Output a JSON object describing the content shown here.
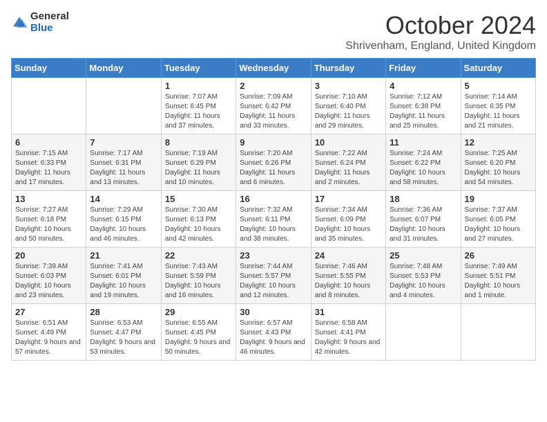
{
  "logo": {
    "general": "General",
    "blue": "Blue"
  },
  "title": "October 2024",
  "subtitle": "Shrivenham, England, United Kingdom",
  "days_of_week": [
    "Sunday",
    "Monday",
    "Tuesday",
    "Wednesday",
    "Thursday",
    "Friday",
    "Saturday"
  ],
  "weeks": [
    [
      {
        "day": "",
        "info": ""
      },
      {
        "day": "",
        "info": ""
      },
      {
        "day": "1",
        "info": "Sunrise: 7:07 AM\nSunset: 6:45 PM\nDaylight: 11 hours and 37 minutes."
      },
      {
        "day": "2",
        "info": "Sunrise: 7:09 AM\nSunset: 6:42 PM\nDaylight: 11 hours and 33 minutes."
      },
      {
        "day": "3",
        "info": "Sunrise: 7:10 AM\nSunset: 6:40 PM\nDaylight: 11 hours and 29 minutes."
      },
      {
        "day": "4",
        "info": "Sunrise: 7:12 AM\nSunset: 6:38 PM\nDaylight: 11 hours and 25 minutes."
      },
      {
        "day": "5",
        "info": "Sunrise: 7:14 AM\nSunset: 6:35 PM\nDaylight: 11 hours and 21 minutes."
      }
    ],
    [
      {
        "day": "6",
        "info": "Sunrise: 7:15 AM\nSunset: 6:33 PM\nDaylight: 11 hours and 17 minutes."
      },
      {
        "day": "7",
        "info": "Sunrise: 7:17 AM\nSunset: 6:31 PM\nDaylight: 11 hours and 13 minutes."
      },
      {
        "day": "8",
        "info": "Sunrise: 7:19 AM\nSunset: 6:29 PM\nDaylight: 11 hours and 10 minutes."
      },
      {
        "day": "9",
        "info": "Sunrise: 7:20 AM\nSunset: 6:26 PM\nDaylight: 11 hours and 6 minutes."
      },
      {
        "day": "10",
        "info": "Sunrise: 7:22 AM\nSunset: 6:24 PM\nDaylight: 11 hours and 2 minutes."
      },
      {
        "day": "11",
        "info": "Sunrise: 7:24 AM\nSunset: 6:22 PM\nDaylight: 10 hours and 58 minutes."
      },
      {
        "day": "12",
        "info": "Sunrise: 7:25 AM\nSunset: 6:20 PM\nDaylight: 10 hours and 54 minutes."
      }
    ],
    [
      {
        "day": "13",
        "info": "Sunrise: 7:27 AM\nSunset: 6:18 PM\nDaylight: 10 hours and 50 minutes."
      },
      {
        "day": "14",
        "info": "Sunrise: 7:29 AM\nSunset: 6:15 PM\nDaylight: 10 hours and 46 minutes."
      },
      {
        "day": "15",
        "info": "Sunrise: 7:30 AM\nSunset: 6:13 PM\nDaylight: 10 hours and 42 minutes."
      },
      {
        "day": "16",
        "info": "Sunrise: 7:32 AM\nSunset: 6:11 PM\nDaylight: 10 hours and 38 minutes."
      },
      {
        "day": "17",
        "info": "Sunrise: 7:34 AM\nSunset: 6:09 PM\nDaylight: 10 hours and 35 minutes."
      },
      {
        "day": "18",
        "info": "Sunrise: 7:36 AM\nSunset: 6:07 PM\nDaylight: 10 hours and 31 minutes."
      },
      {
        "day": "19",
        "info": "Sunrise: 7:37 AM\nSunset: 6:05 PM\nDaylight: 10 hours and 27 minutes."
      }
    ],
    [
      {
        "day": "20",
        "info": "Sunrise: 7:39 AM\nSunset: 6:03 PM\nDaylight: 10 hours and 23 minutes."
      },
      {
        "day": "21",
        "info": "Sunrise: 7:41 AM\nSunset: 6:01 PM\nDaylight: 10 hours and 19 minutes."
      },
      {
        "day": "22",
        "info": "Sunrise: 7:43 AM\nSunset: 5:59 PM\nDaylight: 10 hours and 16 minutes."
      },
      {
        "day": "23",
        "info": "Sunrise: 7:44 AM\nSunset: 5:57 PM\nDaylight: 10 hours and 12 minutes."
      },
      {
        "day": "24",
        "info": "Sunrise: 7:46 AM\nSunset: 5:55 PM\nDaylight: 10 hours and 8 minutes."
      },
      {
        "day": "25",
        "info": "Sunrise: 7:48 AM\nSunset: 5:53 PM\nDaylight: 10 hours and 4 minutes."
      },
      {
        "day": "26",
        "info": "Sunrise: 7:49 AM\nSunset: 5:51 PM\nDaylight: 10 hours and 1 minute."
      }
    ],
    [
      {
        "day": "27",
        "info": "Sunrise: 6:51 AM\nSunset: 4:49 PM\nDaylight: 9 hours and 57 minutes."
      },
      {
        "day": "28",
        "info": "Sunrise: 6:53 AM\nSunset: 4:47 PM\nDaylight: 9 hours and 53 minutes."
      },
      {
        "day": "29",
        "info": "Sunrise: 6:55 AM\nSunset: 4:45 PM\nDaylight: 9 hours and 50 minutes."
      },
      {
        "day": "30",
        "info": "Sunrise: 6:57 AM\nSunset: 4:43 PM\nDaylight: 9 hours and 46 minutes."
      },
      {
        "day": "31",
        "info": "Sunrise: 6:58 AM\nSunset: 4:41 PM\nDaylight: 9 hours and 42 minutes."
      },
      {
        "day": "",
        "info": ""
      },
      {
        "day": "",
        "info": ""
      }
    ]
  ]
}
